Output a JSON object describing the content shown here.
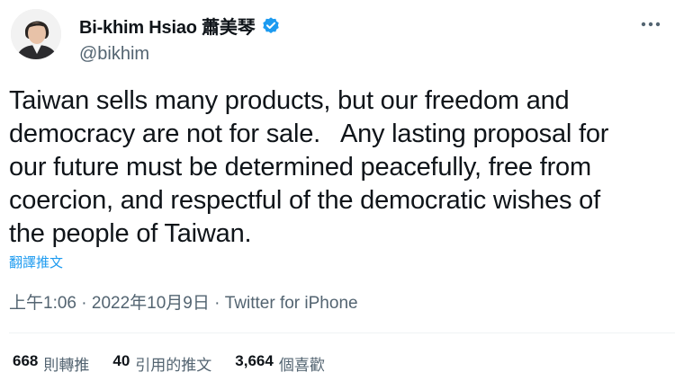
{
  "author": {
    "display_name": "Bi-khim Hsiao 蕭美琴",
    "handle": "@bikhim",
    "verified_icon": "verified-badge-icon",
    "avatar": "profile-photo"
  },
  "more_icon": "more-horizontal-icon",
  "tweet": {
    "text": "Taiwan sells many products, but our freedom and\ndemocracy are not for sale.   Any lasting proposal for\nour future must be determined peacefully, free from\ncoercion, and respectful of the democratic wishes of\nthe people of Taiwan.",
    "translate_label": "翻譯推文"
  },
  "meta": {
    "time": "上午1:06",
    "date": "2022年10月9日",
    "source": "Twitter for iPhone",
    "separator": " · "
  },
  "stats": [
    {
      "count": "668",
      "label": "則轉推"
    },
    {
      "count": "40",
      "label": "引用的推文"
    },
    {
      "count": "3,664",
      "label": "個喜歡"
    }
  ],
  "colors": {
    "accent": "#1d9bf0",
    "text": "#0f1419",
    "secondary": "#536471",
    "divider": "#eff3f4"
  }
}
